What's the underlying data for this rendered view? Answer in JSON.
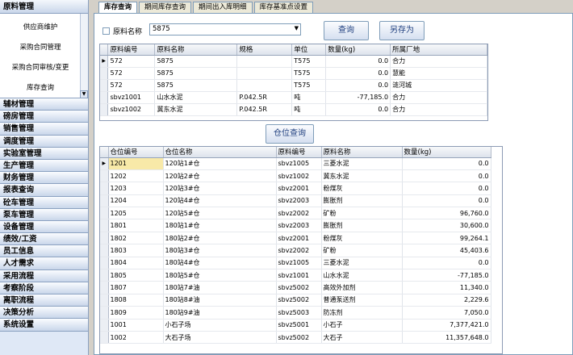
{
  "sidebar": {
    "top_group": "原料管理",
    "sub_items": [
      "供应商维护",
      "采购合同管理",
      "采购合同审核/变更",
      "库存查询"
    ],
    "scroll_arrow": "▼",
    "groups": [
      "辅材管理",
      "磅房管理",
      "销售管理",
      "调度管理",
      "实验室管理",
      "生产管理",
      "财务管理",
      "报表查询",
      "砼车管理",
      "泵车管理",
      "设备管理",
      "绩效/工资",
      "员工信息",
      "人才需求",
      "采用流程",
      "考察阶段",
      "离职流程",
      "决策分析",
      "系统设置"
    ]
  },
  "tabs": [
    "库存查询",
    "期间库存查询",
    "期间出入库明细",
    "库存基准点设置"
  ],
  "filter": {
    "label": "原料名称",
    "value": "5875",
    "dropdown_arrow": "▼"
  },
  "buttons": {
    "query": "查询",
    "save_as": "另存为",
    "warehouse_query": "仓位查询"
  },
  "grid1": {
    "columns": [
      "原料编号",
      "原料名称",
      "规格",
      "单位",
      "数量(kg)",
      "所属厂地"
    ],
    "rows": [
      [
        "572",
        "5875",
        "",
        "T575",
        "0.0",
        "合力"
      ],
      [
        "572",
        "5875",
        "",
        "T575",
        "0.0",
        "慧能"
      ],
      [
        "572",
        "5875",
        "",
        "T575",
        "0.0",
        "涟河城"
      ],
      [
        "sbvz1001",
        "山水水泥",
        "P.042.5R",
        "吨",
        "-77,185.0",
        "合力"
      ],
      [
        "sbvz1002",
        "冀东水泥",
        "P.042.5R",
        "吨",
        "0.0",
        "合力"
      ]
    ]
  },
  "grid2": {
    "columns": [
      "仓位编号",
      "仓位名称",
      "原料编号",
      "原料名称",
      "数量(kg)"
    ],
    "rows": [
      [
        "1201",
        "120站1#仓",
        "sbvz1005",
        "三菱水泥",
        "0.0"
      ],
      [
        "1202",
        "120站2#仓",
        "sbvz1002",
        "冀东水泥",
        "0.0"
      ],
      [
        "1203",
        "120站3#仓",
        "sbvz2001",
        "粉煤灰",
        "0.0"
      ],
      [
        "1204",
        "120站4#仓",
        "sbvz2003",
        "膨胀剂",
        "0.0"
      ],
      [
        "1205",
        "120站5#仓",
        "sbvz2002",
        "矿粉",
        "96,760.0"
      ],
      [
        "1801",
        "180站1#仓",
        "sbvz2003",
        "膨胀剂",
        "30,600.0"
      ],
      [
        "1802",
        "180站2#仓",
        "sbvz2001",
        "粉煤灰",
        "99,264.1"
      ],
      [
        "1803",
        "180站3#仓",
        "sbvz2002",
        "矿粉",
        "45,403.6"
      ],
      [
        "1804",
        "180站4#仓",
        "sbvz1005",
        "三菱水泥",
        "0.0"
      ],
      [
        "1805",
        "180站5#仓",
        "sbvz1001",
        "山水水泥",
        "-77,185.0"
      ],
      [
        "1807",
        "180站7#油",
        "sbvz5002",
        "高效外加剂",
        "11,340.0"
      ],
      [
        "1808",
        "180站8#油",
        "sbvz5002",
        "普通泵送剂",
        "2,229.6"
      ],
      [
        "1809",
        "180站9#油",
        "sbvz5003",
        "防冻剂",
        "7,050.0"
      ],
      [
        "1001",
        "小石子场",
        "sbvz5001",
        "小石子",
        "7,377,421.0"
      ],
      [
        "1002",
        "大石子场",
        "sbvz5002",
        "大石子",
        "11,357,648.0"
      ]
    ]
  },
  "row_marker": "▶"
}
